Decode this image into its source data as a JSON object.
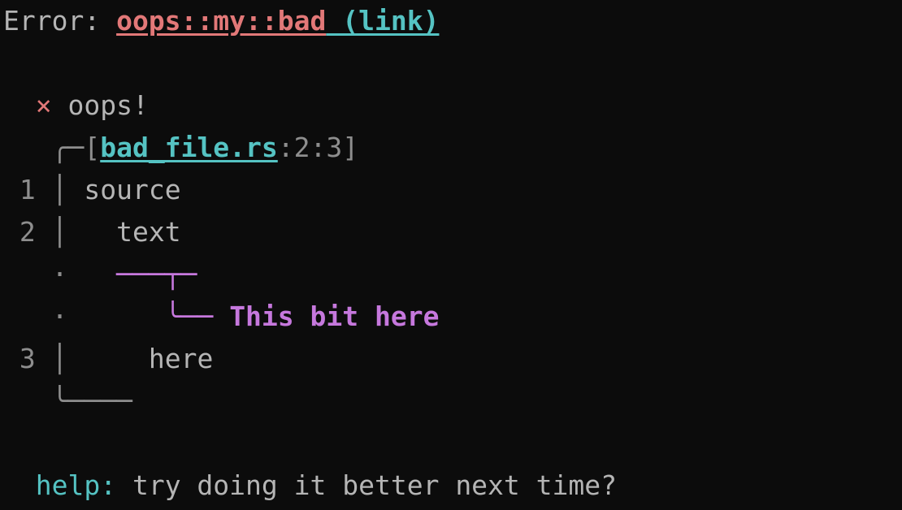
{
  "header": {
    "label": "Error: ",
    "code": "oops::my::bad",
    "link": " (link)"
  },
  "main": {
    "bullet": "×",
    "message": "oops!",
    "file": "bad_file.rs",
    "loc": ":2:3",
    "lines": {
      "n1": "1",
      "n2": "2",
      "n3": "3",
      "src1": "source",
      "src2": "text",
      "src3": "here"
    },
    "underline": "───┬─",
    "arrow": "╰── ",
    "note": "This bit here"
  },
  "footer": {
    "help_label": "help:",
    "help_text": " try doing it better next time?"
  }
}
